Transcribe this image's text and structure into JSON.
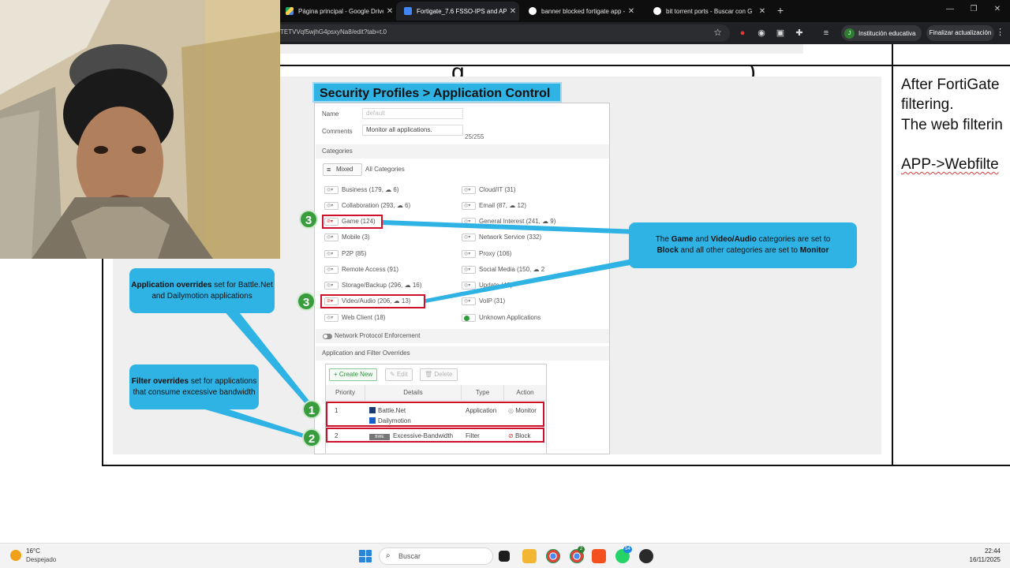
{
  "browser": {
    "tabs": [
      {
        "title": "Página principal - Google Drive",
        "active": false
      },
      {
        "title": "Fortigate_7.6 FSSO-IPS and APP",
        "active": true
      },
      {
        "title": "banner blocked fortigate app -",
        "active": false
      },
      {
        "title": "bit torrent ports - Buscar con G",
        "active": false
      }
    ],
    "url": "TETVVqf5wjhG4psxyNa8/edit?tab=t.0",
    "profile_label": "Institución educativa",
    "profile_initial": "J",
    "update_button": "Finalizar actualización"
  },
  "figure": {
    "header": "Security Profiles > Application Control",
    "name_label": "Name",
    "name_value": "default",
    "comments_label": "Comments",
    "comments_value": "Monitor all applications.",
    "comments_count": "25/255",
    "categories_label": "Categories",
    "mixed_label": "Mixed",
    "all_categories": "All Categories",
    "categories_left": [
      {
        "text": "Business (179, ☁ 6)",
        "action": "monitor"
      },
      {
        "text": "Collaboration (293, ☁ 6)",
        "action": "monitor"
      },
      {
        "text": "Game (124)",
        "action": "block"
      },
      {
        "text": "Mobile (3)",
        "action": "monitor"
      },
      {
        "text": "P2P (85)",
        "action": "monitor"
      },
      {
        "text": "Remote Access (91)",
        "action": "monitor"
      },
      {
        "text": "Storage/Backup (296, ☁ 16)",
        "action": "monitor"
      },
      {
        "text": "Video/Audio (206, ☁ 13)",
        "action": "block"
      },
      {
        "text": "Web Client (18)",
        "action": "monitor"
      }
    ],
    "categories_right": [
      {
        "text": "Cloud/IT (31)",
        "action": "monitor"
      },
      {
        "text": "Email (87, ☁ 12)",
        "action": "monitor"
      },
      {
        "text": "General Interest (241, ☁ 9)",
        "action": "monitor"
      },
      {
        "text": "Network Service (332)",
        "action": "monitor"
      },
      {
        "text": "Proxy (106)",
        "action": "monitor"
      },
      {
        "text": "Social Media (150, ☁ 2",
        "action": "monitor"
      },
      {
        "text": "Update (48)",
        "action": "monitor"
      },
      {
        "text": "VoIP (31)",
        "action": "monitor"
      },
      {
        "text": "Unknown Applications",
        "action": "allow"
      }
    ],
    "npe_label": "Network Protocol Enforcement",
    "overrides_label": "Application and Filter Overrides",
    "buttons": {
      "create": "+ Create New",
      "edit": "✎ Edit",
      "delete": "🗑 Delete"
    },
    "table_headers": [
      "Priority",
      "Details",
      "Type",
      "Action"
    ],
    "rows": [
      {
        "priority": "1",
        "details": [
          "Battle.Net",
          "Dailymotion"
        ],
        "type": "Application",
        "action": "Monitor"
      },
      {
        "priority": "2",
        "tag": "BWE",
        "details": [
          "Excessive-Bandwidth"
        ],
        "type": "Filter",
        "action": "Block"
      }
    ],
    "callouts": {
      "categories": {
        "p1": "The ",
        "b1": "Game",
        "p2": " and ",
        "b2": "Video/Audio",
        "p3": " categories are set to ",
        "b3": "Block",
        "p4": " and all other categories are set to ",
        "b4": "Monitor"
      },
      "app_overrides": {
        "b": "Application overrides",
        "p": " set for Battle.Net and Dailymotion applications"
      },
      "filter_overrides": {
        "b": "Filter overrides",
        "p": " set for applications that consume excessive bandwidth"
      }
    },
    "badges": [
      "3",
      "3",
      "1",
      "2"
    ]
  },
  "slide_title_frag": {
    "left": "g",
    "right": ")"
  },
  "notes": {
    "line1": "After FortiGate",
    "line2": "filtering.",
    "line3": "The web filterin",
    "line4": "APP->Webfilte"
  },
  "taskbar": {
    "temperature": "16°C",
    "weather": "Despejado",
    "search": "Buscar",
    "time": "22:44",
    "date": "16/11/2025",
    "chrome_badge": "2",
    "whatsapp_badge": "54"
  },
  "colors": {
    "callout": "#2fb2e4",
    "badge_green": "#3a9d3d",
    "highlight_red": "#d0112b",
    "chrome_dark": "#202124"
  }
}
